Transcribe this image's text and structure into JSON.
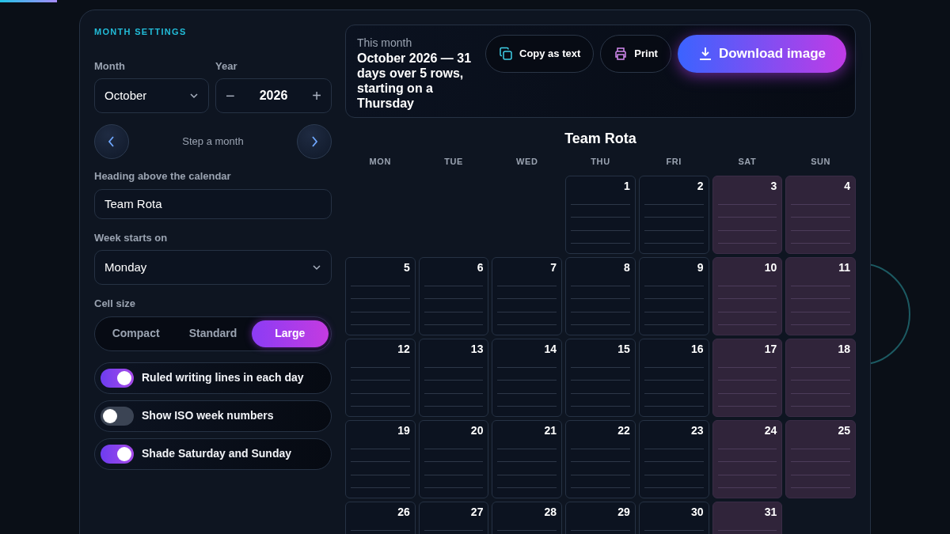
{
  "progress": {
    "level": 0.06
  },
  "settings": {
    "title": "MONTH SETTINGS",
    "month": {
      "label": "Month",
      "value": "October"
    },
    "year": {
      "label": "Year",
      "value": "2026",
      "decrement": "−",
      "increment": "+"
    },
    "step": {
      "label": "Step a month"
    },
    "heading": {
      "label": "Heading above the calendar",
      "value": "Team Rota"
    },
    "week_start": {
      "label": "Week starts on",
      "value": "Monday"
    },
    "cell_size": {
      "label": "Cell size",
      "options": [
        {
          "label": "Compact",
          "selected": false
        },
        {
          "label": "Standard",
          "selected": false
        },
        {
          "label": "Large",
          "selected": true
        }
      ]
    },
    "toggles": [
      {
        "label": "Ruled writing lines in each day",
        "on": true
      },
      {
        "label": "Show ISO week numbers",
        "on": false
      },
      {
        "label": "Shade Saturday and Sunday",
        "on": true
      }
    ]
  },
  "summary": {
    "label": "This month",
    "text": "October 2026 — 31 days over 5 rows, starting on a Thursday"
  },
  "actions": [
    {
      "label": "Copy as text",
      "kind": "copy"
    },
    {
      "label": "Print",
      "kind": "print"
    },
    {
      "label": "Download image",
      "kind": "download"
    }
  ],
  "calendar": {
    "title": "Team Rota",
    "weekdays": [
      "MON",
      "TUE",
      "WED",
      "THU",
      "FRI",
      "SAT",
      "SUN"
    ],
    "weeks": [
      {
        "days": [
          {
            "day": "1",
            "weekend": false
          },
          {
            "day": "2",
            "weekend": false
          },
          {
            "day": "3",
            "weekend": true
          },
          {
            "day": "4",
            "weekend": true
          }
        ]
      },
      {
        "days": [
          {
            "day": "5",
            "weekend": false
          },
          {
            "day": "6",
            "weekend": false
          },
          {
            "day": "7",
            "weekend": false
          },
          {
            "day": "8",
            "weekend": false
          },
          {
            "day": "9",
            "weekend": false
          },
          {
            "day": "10",
            "weekend": true
          },
          {
            "day": "11",
            "weekend": true
          }
        ]
      },
      {
        "days": [
          {
            "day": "12",
            "weekend": false
          },
          {
            "day": "13",
            "weekend": false
          },
          {
            "day": "14",
            "weekend": false
          },
          {
            "day": "15",
            "weekend": false
          },
          {
            "day": "16",
            "weekend": false
          },
          {
            "day": "17",
            "weekend": true
          },
          {
            "day": "18",
            "weekend": true
          }
        ]
      },
      {
        "days": [
          {
            "day": "19",
            "weekend": false
          },
          {
            "day": "20",
            "weekend": false
          },
          {
            "day": "21",
            "weekend": false
          },
          {
            "day": "22",
            "weekend": false
          },
          {
            "day": "23",
            "weekend": false
          },
          {
            "day": "24",
            "weekend": true
          },
          {
            "day": "25",
            "weekend": true
          }
        ]
      },
      {
        "days": [
          {
            "day": "26",
            "weekend": false
          },
          {
            "day": "27",
            "weekend": false
          },
          {
            "day": "28",
            "weekend": false
          },
          {
            "day": "29",
            "weekend": false
          },
          {
            "day": "30",
            "weekend": false
          },
          {
            "day": "31",
            "weekend": true
          }
        ]
      }
    ]
  }
}
